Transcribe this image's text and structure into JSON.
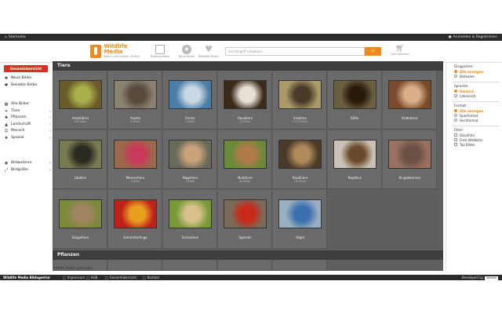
{
  "topbar": {
    "home_label": "Startseite",
    "login_label": "Anmelden & Registrieren"
  },
  "header": {
    "logo_title": "Wildlife Media",
    "logo_subtitle": "Natur und Umwelt im Bild",
    "nav": [
      {
        "label": "Bildersuchbox",
        "icon": "image-search-icon"
      },
      {
        "label": "Neue Bilder",
        "icon": "star-icon"
      },
      {
        "label": "Beliebte Bilder",
        "icon": "heart-icon"
      }
    ],
    "search_placeholder": "Suchbegriff eingeben...",
    "cart_label": "Leuchtkasten"
  },
  "sidebar": {
    "overview_button": "Gesamtübersicht",
    "items_top": [
      {
        "label": "Neue Bilder",
        "icon": "star-icon"
      },
      {
        "label": "Beliebte Bilder",
        "icon": "heart-icon"
      }
    ],
    "items_cat": [
      {
        "label": "Alle Bilder",
        "icon": "images-icon"
      },
      {
        "label": "Tiere",
        "icon": "paw-icon"
      },
      {
        "label": "Pflanzen",
        "icon": "leaf-icon"
      },
      {
        "label": "Landschaft",
        "icon": "mountain-icon"
      },
      {
        "label": "Mensch",
        "icon": "person-icon"
      },
      {
        "label": "Spezial",
        "icon": "special-icon"
      }
    ],
    "items_tools": [
      {
        "label": "Bildautoren",
        "icon": "camera-icon"
      },
      {
        "label": "Bildgröße",
        "icon": "resize-icon"
      }
    ]
  },
  "sections": {
    "tiere": "Tiere",
    "pflanzen": "Pflanzen"
  },
  "tiles": [
    {
      "name": "Amphibien",
      "count": "104 Bilder",
      "colors": [
        "#6b5a2a",
        "#a7b04a"
      ]
    },
    {
      "name": "Asseln",
      "count": "2 Bilder",
      "colors": [
        "#8a8170",
        "#5a4a3a"
      ]
    },
    {
      "name": "Fische",
      "count": "1 Bilder",
      "colors": [
        "#4b7ea8",
        "#c9d8e3"
      ]
    },
    {
      "name": "Haustiere",
      "count": "24 Bilder",
      "colors": [
        "#3a2a1a",
        "#e6e0d5"
      ]
    },
    {
      "name": "Insekten",
      "count": "1.712 Bilder",
      "colors": [
        "#a99a6a",
        "#4a3a2a"
      ]
    },
    {
      "name": "Käfer",
      "count": "",
      "colors": [
        "#6a6040",
        "#2a1a0a"
      ]
    },
    {
      "name": "Krebstiere",
      "count": "",
      "colors": [
        "#7a4a2a",
        "#d9b08a"
      ]
    },
    {
      "name": "Libellen",
      "count": "",
      "colors": [
        "#7a7a50",
        "#2a2a20"
      ]
    },
    {
      "name": "Meerestiere",
      "count": "2 Bilder",
      "colors": [
        "#9a6a4a",
        "#c83a5a"
      ]
    },
    {
      "name": "Nagetiere",
      "count": "3 Bilder",
      "colors": [
        "#6a6a5a",
        "#c9a27a"
      ]
    },
    {
      "name": "Nutztiere",
      "count": "64 Bilder",
      "colors": [
        "#6a8a3a",
        "#b07a4a"
      ]
    },
    {
      "name": "Raubtiere",
      "count": "172 Bilder",
      "colors": [
        "#4a3a2a",
        "#b08a5a"
      ]
    },
    {
      "name": "Reptilien",
      "count": "",
      "colors": [
        "#c9c2b5",
        "#6a4a2a"
      ]
    },
    {
      "name": "Ringelwürmer",
      "count": "",
      "colors": [
        "#9a7060",
        "#6a5045"
      ]
    },
    {
      "name": "Säugetiere",
      "count": "",
      "colors": [
        "#7a8a3a",
        "#a08560"
      ]
    },
    {
      "name": "Schmetterlinge",
      "count": "",
      "colors": [
        "#c0201a",
        "#e8a020"
      ]
    },
    {
      "name": "Schnecken",
      "count": "",
      "colors": [
        "#7a9a3a",
        "#d8c08a"
      ]
    },
    {
      "name": "Spinnen",
      "count": "",
      "colors": [
        "#7a6a5a",
        "#c82a1a"
      ]
    },
    {
      "name": "Vögel",
      "count": "",
      "colors": [
        "#9ab0c0",
        "#3a70b0"
      ]
    }
  ],
  "filters": {
    "gruppieren": {
      "title": "Gruppieren:",
      "options": [
        {
          "label": "Alle anzeigen",
          "on": true
        },
        {
          "label": "Bildname",
          "on": false
        }
      ]
    },
    "sprache": {
      "title": "Sprache:",
      "options": [
        {
          "label": "Deutsch",
          "on": true
        },
        {
          "label": "Lateinisch",
          "on": false
        }
      ]
    },
    "format": {
      "title": "Format:",
      "options": [
        {
          "label": "Alle anzeigen",
          "on": true
        },
        {
          "label": "Querformat",
          "on": false
        },
        {
          "label": "Hochformat",
          "on": false
        }
      ]
    },
    "filter": {
      "title": "Filter:",
      "options": [
        {
          "label": "Stockfoto"
        },
        {
          "label": "Freie Wildbahn"
        },
        {
          "label": "Top Bilder"
        }
      ]
    }
  },
  "found_text": "24066 Bilder gefunden",
  "footer": {
    "brand": "Wildlife Media Bildagentur",
    "links": [
      "Impressum",
      "AGB",
      "Gesamtübersicht",
      "Kontakt"
    ],
    "developed_by": "Developed by",
    "dev_logo": "Wildlife"
  },
  "accent": "#f08a1c",
  "danger": "#d93025"
}
